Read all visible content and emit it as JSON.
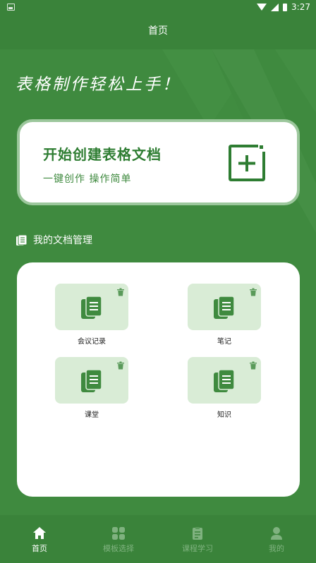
{
  "status_bar": {
    "time": "3:27"
  },
  "header": {
    "title": "首页"
  },
  "hero": {
    "slogan": "表格制作轻松上手！"
  },
  "create_card": {
    "title": "开始创建表格文档",
    "subtitle": "一键创作  操作简单",
    "icon": "add-document-icon"
  },
  "docs_section": {
    "heading": "我的文档管理",
    "items": [
      {
        "name": "会议记录"
      },
      {
        "name": "笔记"
      },
      {
        "name": "课堂"
      },
      {
        "name": "知识"
      }
    ]
  },
  "tab_bar": {
    "active": "首页",
    "tabs": [
      {
        "label": "首页",
        "icon": "home-icon"
      },
      {
        "label": "模板选择",
        "icon": "template-grid-icon"
      },
      {
        "label": "课程学习",
        "icon": "clipboard-icon"
      },
      {
        "label": "我的",
        "icon": "profile-icon"
      }
    ]
  },
  "colors": {
    "primary": "#3f8a3f",
    "bar": "#3a833a",
    "accent_text": "#2e7d32",
    "tile_bg": "#d9ecd6",
    "card_border": "#9cc79c",
    "inactive_tab": "#7fb27f"
  }
}
